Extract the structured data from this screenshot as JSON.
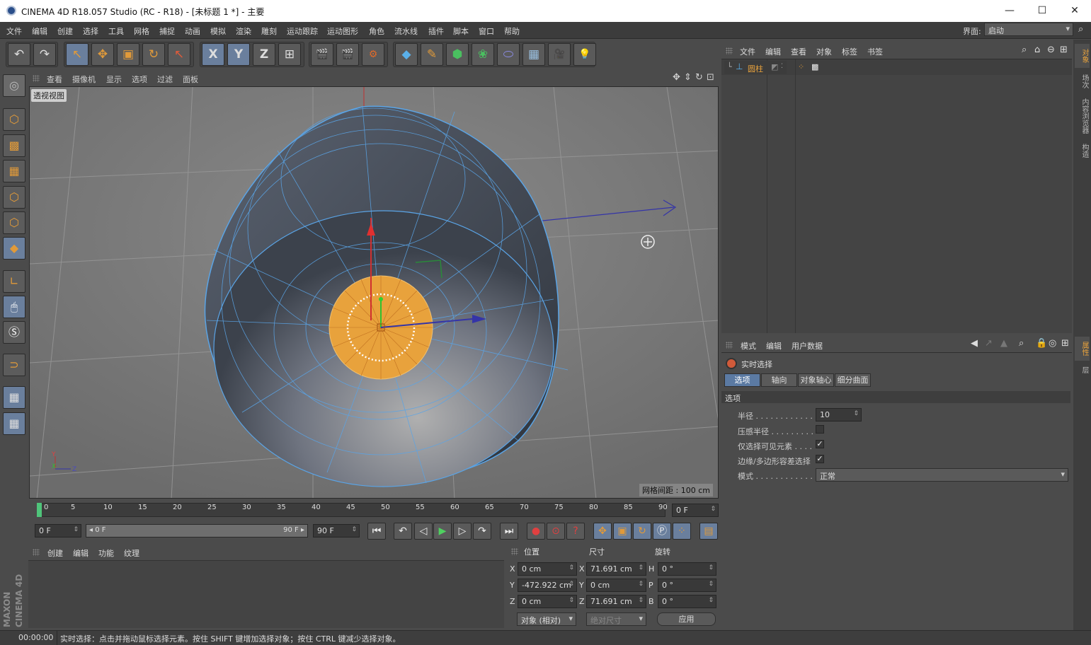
{
  "window": {
    "title": "CINEMA 4D R18.057 Studio (RC - R18) - [未标题 1 *] - 主要",
    "min": "—",
    "max": "☐",
    "close": "✕"
  },
  "menubar": {
    "items": [
      "文件",
      "编辑",
      "创建",
      "选择",
      "工具",
      "网格",
      "捕捉",
      "动画",
      "模拟",
      "渲染",
      "雕刻",
      "运动跟踪",
      "运动图形",
      "角色",
      "流水线",
      "插件",
      "脚本",
      "窗口",
      "帮助"
    ],
    "layout_label": "界面:",
    "layout_value": "启动"
  },
  "toolbar": {
    "undo": "↶",
    "redo": "↷",
    "select": "↖",
    "move": "✥",
    "scale": "▣",
    "rotate": "↻",
    "live": "↖",
    "x": "X",
    "y": "Y",
    "z": "Z",
    "coord": "⊞",
    "render_view": "🎬",
    "render_pic": "🎬",
    "render_settings": "⚙",
    "cube": "◆",
    "pen": "✎",
    "nurbs": "⬢",
    "cloner": "❀",
    "deformer": "⬭",
    "floor": "▦",
    "camera": "🎥",
    "light": "💡"
  },
  "viewport": {
    "menu": [
      "查看",
      "摄像机",
      "显示",
      "选项",
      "过滤",
      "面板"
    ],
    "label": "透视视图",
    "grid_spacing": "网格间距 : 100 cm",
    "axis_x": "X",
    "axis_y": "Y",
    "axis_z": "Z"
  },
  "timeline": {
    "ticks": [
      "0",
      "5",
      "10",
      "15",
      "20",
      "25",
      "30",
      "35",
      "40",
      "45",
      "50",
      "55",
      "60",
      "65",
      "70",
      "75",
      "80",
      "85",
      "90"
    ],
    "current_frame": "0 F"
  },
  "transport": {
    "start": "0 F",
    "range_start": "◂ 0 F",
    "range_end": "90 F ▸",
    "end": "90 F"
  },
  "material": {
    "menu": [
      "创建",
      "编辑",
      "功能",
      "纹理"
    ]
  },
  "coords": {
    "headers": [
      "位置",
      "尺寸",
      "旋转"
    ],
    "rows": [
      {
        "a": "X",
        "pos": "0 cm",
        "b": "X",
        "size": "71.691 cm",
        "c": "H",
        "rot": "0 °"
      },
      {
        "a": "Y",
        "pos": "-472.922 cm",
        "b": "Y",
        "size": "0 cm",
        "c": "P",
        "rot": "0 °"
      },
      {
        "a": "Z",
        "pos": "0 cm",
        "b": "Z",
        "size": "71.691 cm",
        "c": "B",
        "rot": "0 °"
      }
    ],
    "mode": "对象 (相对)",
    "size_mode": "绝对尺寸",
    "apply": "应用"
  },
  "object_manager": {
    "menu": [
      "文件",
      "编辑",
      "查看",
      "对象",
      "标签",
      "书签"
    ],
    "object_name": "圆柱"
  },
  "attributes": {
    "menu": [
      "模式",
      "编辑",
      "用户数据"
    ],
    "tool_name": "实时选择",
    "tabs": [
      "选项",
      "轴向",
      "对象轴心",
      "细分曲面"
    ],
    "section": "选项",
    "radius_label": "半径 . . . . . . . . . . . . . .",
    "radius_value": "10",
    "pressure_label": "压感半径 . . . . . . . . .",
    "visible_label": "仅选择可见元素 . . . .",
    "visible_check": "✓",
    "tolerance_label": "边缘/多边形容差选择",
    "tolerance_check": "✓",
    "mode_label": "模式 . . . . . . . . . . . . . .",
    "mode_value": "正常"
  },
  "right_tabs": [
    "对象",
    "场次",
    "内容浏览器",
    "构造"
  ],
  "right_tabs2": [
    "属性",
    "层"
  ],
  "status": {
    "time": "00:00:00",
    "text": "实时选择：点击并拖动鼠标选择元素。按住 SHIFT 键增加选择对象；按住 CTRL 键减少选择对象。"
  },
  "brand": "MAXON CINEMA 4D"
}
